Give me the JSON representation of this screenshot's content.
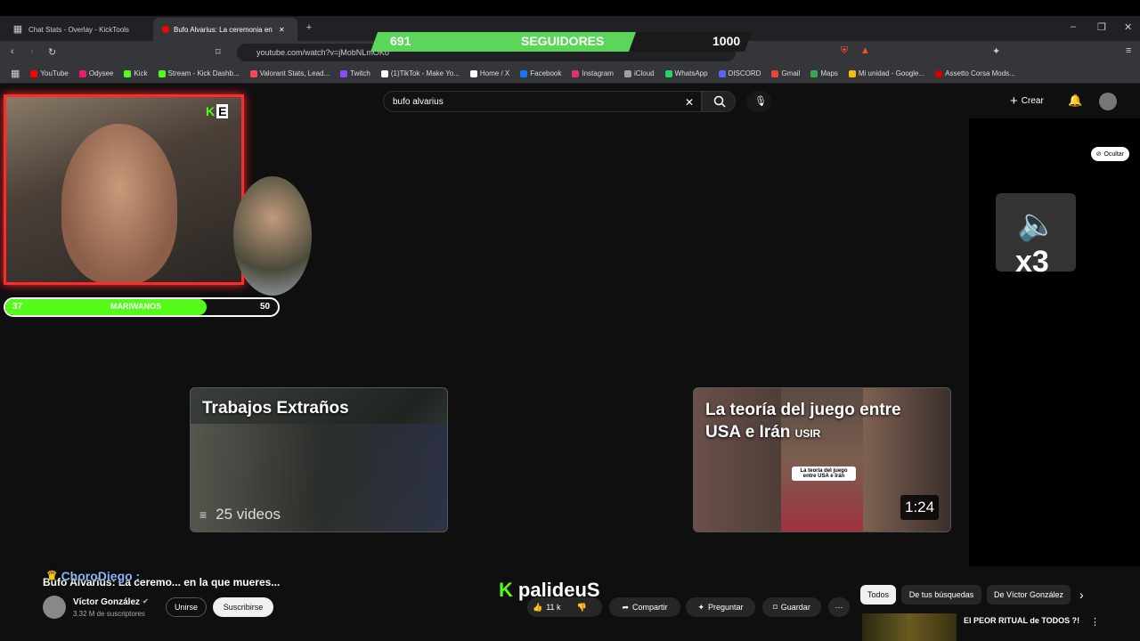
{
  "browser": {
    "tabs": [
      {
        "label": "Chat Stats - Overlay - KickTools"
      },
      {
        "label": "Bufo Alvarius: La ceremonia en la"
      }
    ],
    "new_tab": "+",
    "url": "youtube.com/watch?v=jMobNLmOKo",
    "bookmarks": [
      {
        "label": "YouTube",
        "color": "#ff0000"
      },
      {
        "label": "Odysee",
        "color": "#ef1970"
      },
      {
        "label": "Kick",
        "color": "#53fc18"
      },
      {
        "label": "Stream - Kick Dashb...",
        "color": "#53fc18"
      },
      {
        "label": "Valorant Stats, Lead...",
        "color": "#ff4655"
      },
      {
        "label": "Twitch",
        "color": "#9146ff"
      },
      {
        "label": "(1)TikTok - Make Yo...",
        "color": "#ffffff"
      },
      {
        "label": "Home / X",
        "color": "#ffffff"
      },
      {
        "label": "Facebook",
        "color": "#1877f2"
      },
      {
        "label": "Instagram",
        "color": "#e1306c"
      },
      {
        "label": "iCloud",
        "color": "#9aa0a6"
      },
      {
        "label": "WhatsApp",
        "color": "#25d366"
      },
      {
        "label": "DISCORD",
        "color": "#5865f2"
      },
      {
        "label": "Gmail",
        "color": "#ea4335"
      },
      {
        "label": "Maps",
        "color": "#34a853"
      },
      {
        "label": "Mi unidad - Google...",
        "color": "#fbbc04"
      },
      {
        "label": "Assetto Corsa Mods...",
        "color": "#d00000"
      }
    ]
  },
  "overlay": {
    "followers_current": "691",
    "followers_label": "SEGUIDORES",
    "followers_goal": "1000",
    "followers_progress": 0.691,
    "sub_current": "37",
    "sub_label": "MARIWANOS",
    "sub_goal": "50",
    "sub_progress": 0.74,
    "kick_badge": "E",
    "chat_user": "ChoroDiego :",
    "watermark": "palideuS"
  },
  "youtube": {
    "search_value": "bufo alvarius",
    "create_label": "Crear",
    "hide_label": "Ocultar",
    "mute_multiplier": "x3",
    "end_cards": [
      {
        "title": "Trabajos Extraños",
        "meta": "25 videos"
      },
      {
        "title": "La teoría del juego entre USA e Irán",
        "caption": "USIR",
        "inner_caption": "La teoría del juego entre USA e Irán",
        "duration": "1:24"
      }
    ],
    "video_title": "Bufo Alvarius: La ceremo... en la que mueres...",
    "channel_name": "Víctor González",
    "channel_subs": "3.32 M de suscriptores",
    "join_label": "Unirse",
    "subscribe_label": "Suscribirse",
    "like_count": "11 k",
    "share_label": "Compartir",
    "ask_label": "Preguntar",
    "save_label": "Guardar",
    "more_label": "⋯",
    "chips": [
      "Todos",
      "De tus búsquedas",
      "De Víctor González"
    ],
    "rec_title": "El PEOR RITUAL de TODOS ?!"
  },
  "colors": {
    "kick_green": "#53fc18",
    "overlay_red": "#ff2a2a",
    "yt_bg": "#0f0f0f"
  }
}
